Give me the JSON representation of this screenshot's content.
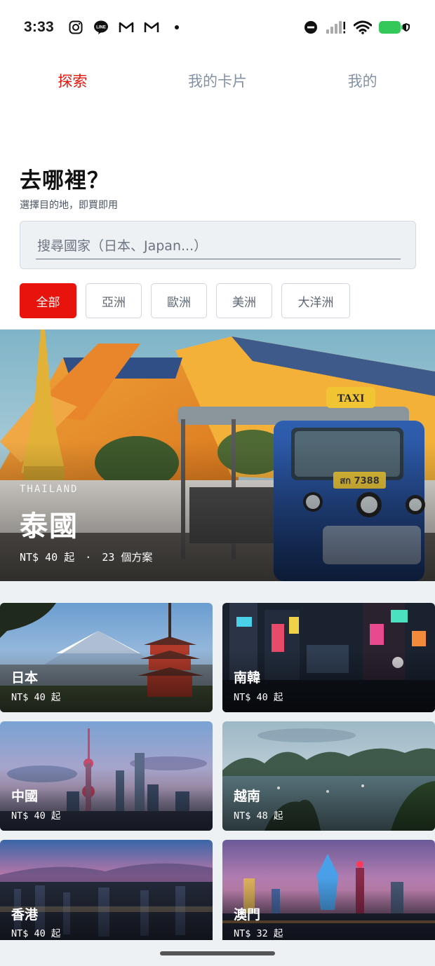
{
  "status_bar": {
    "time": "3:33",
    "left_icons": [
      "instagram-icon",
      "line-icon",
      "gmail-icon",
      "gmail-icon",
      "dot-icon"
    ],
    "right_icons": [
      "do-not-disturb-icon",
      "signal-icon",
      "wifi-icon",
      "battery-icon",
      "vpn-shield-icon"
    ],
    "battery_fill": 1.0
  },
  "tabs": [
    {
      "label": "探索",
      "active": true
    },
    {
      "label": "我的卡片",
      "active": false
    },
    {
      "label": "我的",
      "active": false
    }
  ],
  "header": {
    "title": "去哪裡？",
    "subtitle": "選擇目的地，即買即用"
  },
  "search": {
    "placeholder": "搜尋國家（日本、Japan...）",
    "value": ""
  },
  "regions": [
    {
      "label": "全部",
      "active": true
    },
    {
      "label": "亞洲",
      "active": false
    },
    {
      "label": "歐洲",
      "active": false
    },
    {
      "label": "美洲",
      "active": false
    },
    {
      "label": "大洋洲",
      "active": false
    }
  ],
  "featured": {
    "name_en": "THAILAND",
    "name": "泰國",
    "price": "NT$ 40 起",
    "separator": "·",
    "plans": "23 個方案",
    "taxi_sign": "TAXI",
    "plate": "สก 7388"
  },
  "destinations": [
    {
      "name": "日本",
      "price": "NT$ 40 起"
    },
    {
      "name": "南韓",
      "price": "NT$ 40 起"
    },
    {
      "name": "中國",
      "price": "NT$ 40 起"
    },
    {
      "name": "越南",
      "price": "NT$ 48 起"
    },
    {
      "name": "香港",
      "price": "NT$ 40 起"
    },
    {
      "name": "澳門",
      "price": "NT$ 32 起"
    }
  ],
  "colors": {
    "accent": "#e8130c",
    "tab_inactive": "#8492a6",
    "grid_bg": "#eef1f4"
  }
}
